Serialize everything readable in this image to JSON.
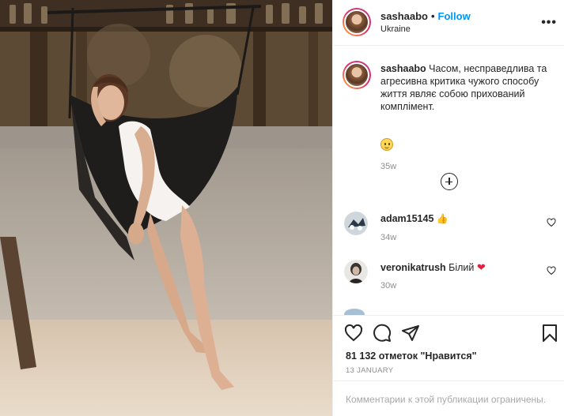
{
  "header": {
    "username": "sashaabo",
    "separator": "•",
    "follow_label": "Follow",
    "location": "Ukraine",
    "more_label": "•••"
  },
  "caption": {
    "username": "sashaabo",
    "text": "Часом, несправедлива та агресивна критика чужого способу життя являє собою прихований комплімент.",
    "time": "35w"
  },
  "comments": [
    {
      "username": "adam15145",
      "text": "",
      "emoji": "👍",
      "time": "34w"
    },
    {
      "username": "veronikatrush",
      "text": "Білий",
      "emoji": "❤",
      "time": "30w"
    }
  ],
  "actions": {
    "likes": "81 132 отметок \"Нравится\"",
    "date": "13 JANUARY"
  },
  "comment_bar": {
    "text": "Комментарии к этой публикации ограничены."
  },
  "colors": {
    "link": "#0095f6",
    "muted": "#8e8e8e",
    "border": "#efefef"
  }
}
